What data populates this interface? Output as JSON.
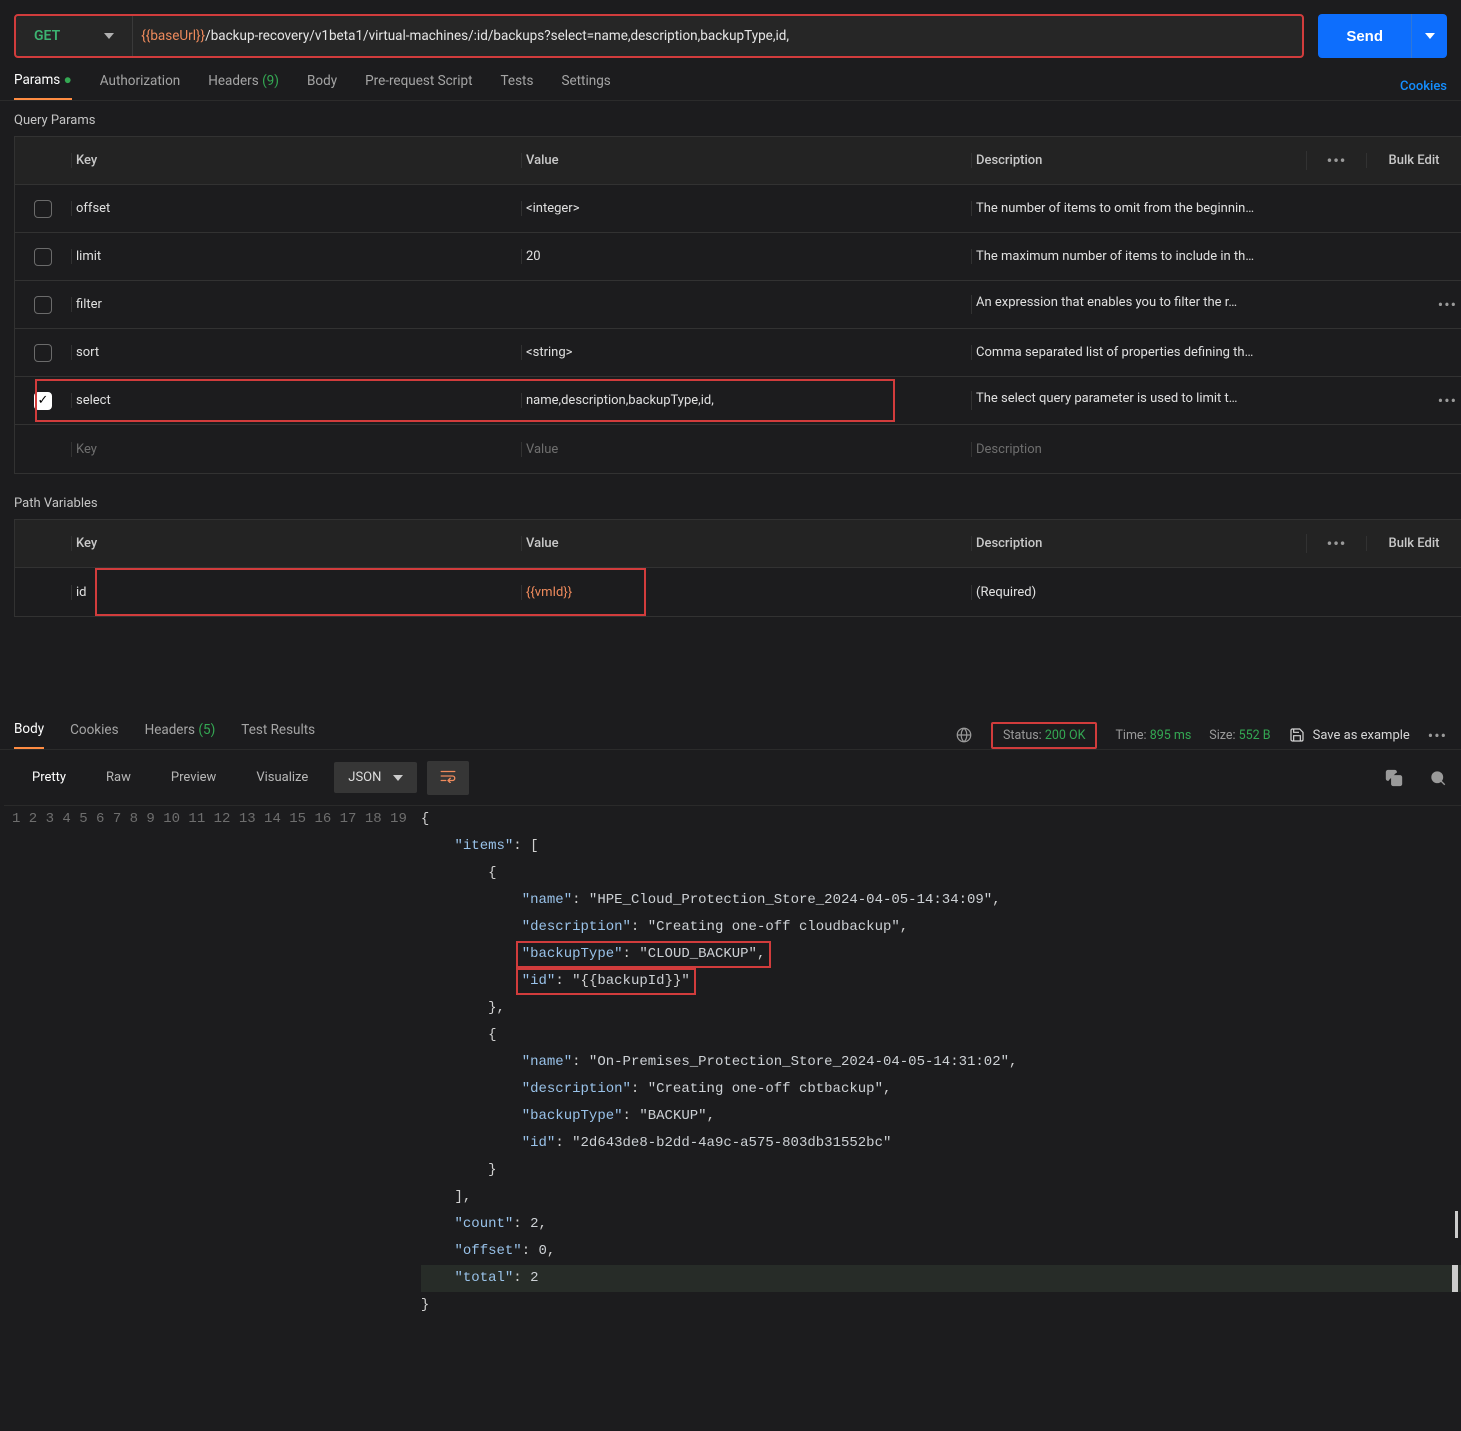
{
  "request": {
    "method": "GET",
    "url_var": "{{baseUrl}}",
    "url_path": "/backup-recovery/v1beta1/virtual-machines/:id/backups?select=name,description,backupType,id,",
    "send_label": "Send"
  },
  "request_tabs": {
    "params": "Params",
    "auth": "Authorization",
    "headers": "Headers",
    "headers_count": "(9)",
    "body": "Body",
    "prs": "Pre-request Script",
    "tests": "Tests",
    "settings": "Settings",
    "cookies": "Cookies"
  },
  "query_params": {
    "title": "Query Params",
    "hdr_key": "Key",
    "hdr_val": "Value",
    "hdr_desc": "Description",
    "bulk": "Bulk Edit",
    "rows": [
      {
        "checked": false,
        "key": "offset",
        "value": "<integer>",
        "desc": "The number of items to omit from the beginnin…"
      },
      {
        "checked": false,
        "key": "limit",
        "value": "20",
        "desc": "The maximum number of items to include in th…"
      },
      {
        "checked": false,
        "key": "filter",
        "value": "",
        "desc": "An expression that enables you to filter the r…",
        "desc_dots": true
      },
      {
        "checked": false,
        "key": "sort",
        "value": "<string>",
        "desc": "Comma separated list of properties defining th…"
      },
      {
        "checked": true,
        "key": "select",
        "value": "name,description,backupType,id,",
        "desc": "The select query parameter is used to limit t…",
        "highlight": true,
        "desc_dots": true
      }
    ],
    "ph_key": "Key",
    "ph_val": "Value",
    "ph_desc": "Description"
  },
  "path_vars": {
    "title": "Path Variables",
    "hdr_key": "Key",
    "hdr_val": "Value",
    "hdr_desc": "Description",
    "bulk": "Bulk Edit",
    "rows": [
      {
        "key": "id",
        "value": "{{vmId}}",
        "desc": "(Required)",
        "highlight": true,
        "var": true
      }
    ]
  },
  "response_tabs": {
    "body": "Body",
    "cookies": "Cookies",
    "headers": "Headers",
    "headers_count": "(5)",
    "tests": "Test Results",
    "status_label": "Status:",
    "status_value": "200 OK",
    "time_label": "Time:",
    "time_value": "895 ms",
    "size_label": "Size:",
    "size_value": "552 B",
    "save": "Save as example"
  },
  "view_tabs": {
    "pretty": "Pretty",
    "raw": "Raw",
    "preview": "Preview",
    "visualize": "Visualize",
    "format": "JSON"
  },
  "response_body": {
    "lines": [
      "{",
      "    \"items\": [",
      "        {",
      "            \"name\": \"HPE_Cloud_Protection_Store_2024-04-05-14:34:09\",",
      "            \"description\": \"Creating one-off cloudbackup\",",
      "            \"backupType\": \"CLOUD_BACKUP\",",
      "            \"id\": \"{{backupId}}\"",
      "        },",
      "        {",
      "            \"name\": \"On-Premises_Protection_Store_2024-04-05-14:31:02\",",
      "            \"description\": \"Creating one-off cbtbackup\",",
      "            \"backupType\": \"BACKUP\",",
      "            \"id\": \"2d643de8-b2dd-4a9c-a575-803db31552bc\"",
      "        }",
      "    ],",
      "    \"count\": 2,",
      "    \"offset\": 0,",
      "    \"total\": 2",
      "}"
    ],
    "lines_numbers": [
      "1",
      "2",
      "3",
      "4",
      "5",
      "6",
      "7",
      "8",
      "9",
      "10",
      "11",
      "12",
      "13",
      "14",
      "15",
      "16",
      "17",
      "18",
      "19"
    ]
  }
}
